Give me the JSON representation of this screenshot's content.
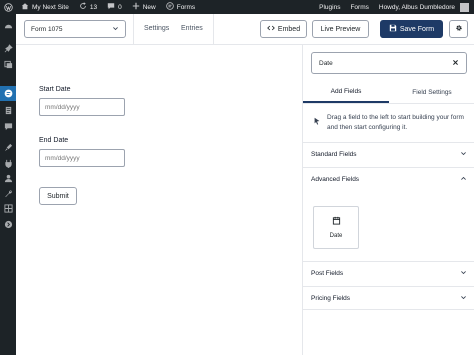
{
  "adminbar": {
    "site_name": "My Next Site",
    "updates_count": "13",
    "comments_count": "0",
    "new_label": "New",
    "forms_label": "Forms",
    "plugins_label": "Plugins",
    "forms_right_label": "Forms",
    "greeting": "Howdy, Albus Dumbledore"
  },
  "toolbar": {
    "form_selector_value": "Form 1075",
    "settings_label": "Settings",
    "entries_label": "Entries",
    "embed_label": "Embed",
    "live_preview_label": "Live Preview",
    "save_label": "Save Form"
  },
  "canvas": {
    "start_date_label": "Start Date",
    "start_date_placeholder": "mm/dd/yyyy",
    "end_date_label": "End Date",
    "end_date_placeholder": "mm/dd/yyyy",
    "submit_label": "Submit"
  },
  "panel": {
    "search_value": "Date",
    "tabs": [
      {
        "label": "Add Fields",
        "active": true
      },
      {
        "label": "Field Settings",
        "active": false
      }
    ],
    "hint": "Drag a field to the left to start building your form and then start configuring it.",
    "sections": {
      "standard": "Standard Fields",
      "advanced": "Advanced Fields",
      "post": "Post Fields",
      "pricing": "Pricing Fields"
    },
    "advanced_tiles": [
      {
        "label": "Date",
        "icon": "calendar-icon"
      }
    ]
  },
  "colors": {
    "admin_dark": "#1d2327",
    "admin_active": "#2271b1",
    "primary_button": "#1e3a66"
  }
}
